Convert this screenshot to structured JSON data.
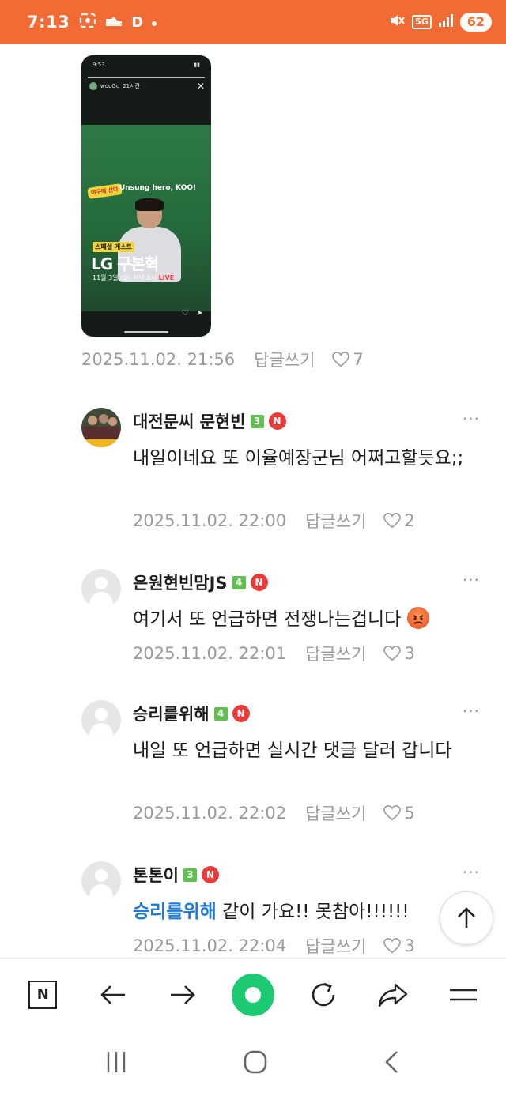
{
  "status_bar": {
    "time": "7:13",
    "left_icons": [
      "screenshot-icon",
      "shoe-icon",
      "D"
    ],
    "network": "5G",
    "battery": "62"
  },
  "story": {
    "mini_time": "9:53",
    "mini_user": "wooGu",
    "mini_age": "21시간",
    "badge": "야구에 산다",
    "headline": "Unsung hero, KOO!",
    "subtitle": "스페셜 게스트",
    "big_text": "LG 구본혁",
    "date_text": "11월 3일 (월) 저녁 6시",
    "live": "LIVE"
  },
  "post_meta": {
    "timestamp": "2025.11.02. 21:56",
    "reply_label": "답글쓰기",
    "likes": "7"
  },
  "comments": [
    {
      "name": "대전문씨 문현빈",
      "level": "3",
      "text": "내일이네요 또 이율예장군님 어쩌고할듯요;;",
      "timestamp": "2025.11.02. 22:00",
      "reply_label": "답글쓰기",
      "likes": "2"
    },
    {
      "name": "은원현빈맘JS",
      "level": "4",
      "text": "여기서 또 언급하면 전쟁나는겁니다",
      "timestamp": "2025.11.02. 22:01",
      "reply_label": "답글쓰기",
      "likes": "3"
    },
    {
      "name": "승리를위해",
      "level": "4",
      "text": "내일 또 언급하면 실시간 댓글 달러 갑니다",
      "timestamp": "2025.11.02. 22:02",
      "reply_label": "답글쓰기",
      "likes": "5"
    },
    {
      "name": "톤톤이",
      "level": "3",
      "mention": "승리를위해",
      "text": " 같이 가요!! 못참아!!!!!!",
      "timestamp": "2025.11.02. 22:04",
      "reply_label": "답글쓰기",
      "likes": "3"
    }
  ],
  "new_badge": "N",
  "more_label": "···",
  "toolbar": {
    "n_label": "N",
    "items": [
      "naver-home-icon",
      "back-arrow-icon",
      "forward-arrow-icon",
      "green-home-icon",
      "refresh-icon",
      "share-icon",
      "menu-icon"
    ]
  },
  "colors": {
    "status_bar": "#f26b35",
    "mention": "#1f7bd8",
    "level_badge": "#5fbf4f",
    "new_badge": "#ea3b3b",
    "green": "#1ec973"
  }
}
